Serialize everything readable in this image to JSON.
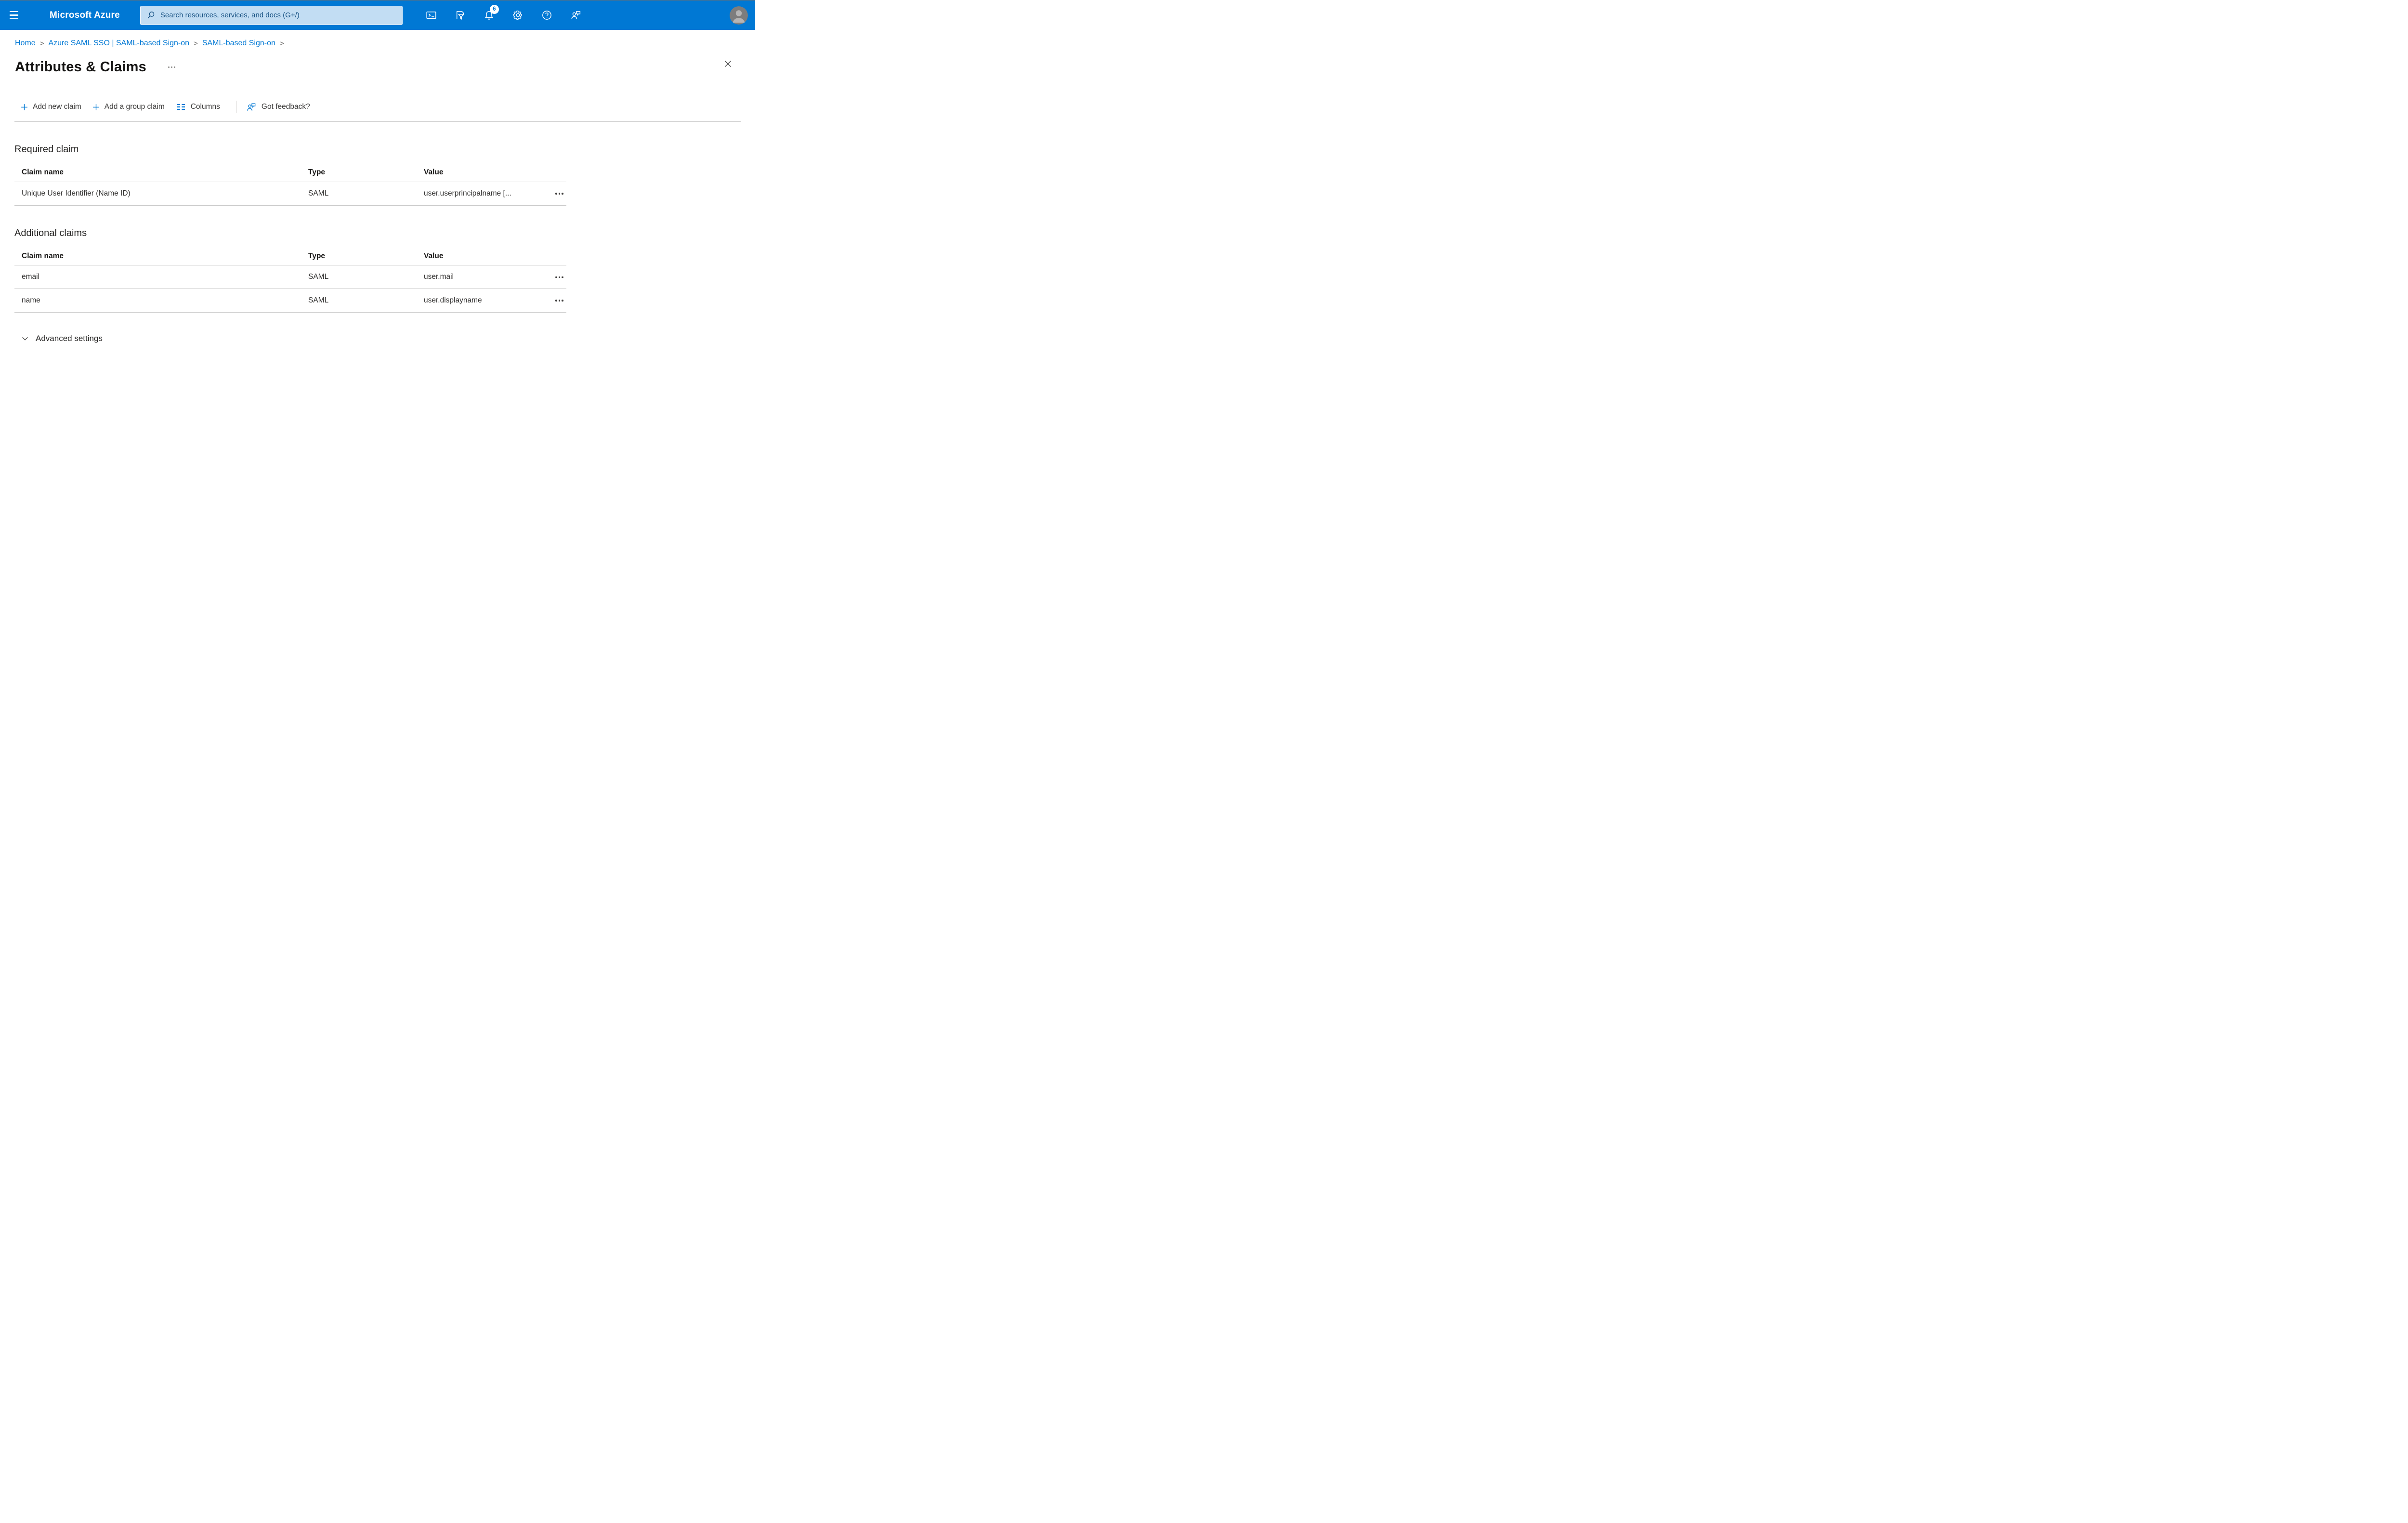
{
  "colors": {
    "accent": "#0078d4",
    "topbar_bg": "#0078d4",
    "search_bg": "#c2ddf3",
    "search_text": "#1a5485",
    "link": "#0078d4",
    "text_primary": "#323130",
    "heading": "#1b1a19",
    "toolbar_rule": "#d7d7d7",
    "table_header_border": "#e5e5e5",
    "table_row_border": "#c8c8c8"
  },
  "topbar": {
    "brand": "Microsoft Azure",
    "search_placeholder": "Search resources, services, and docs (G+/)",
    "notification_count": "6",
    "icons": [
      "cloud-shell",
      "filter",
      "notifications",
      "settings",
      "help",
      "feedback"
    ]
  },
  "breadcrumb": {
    "separator": ">",
    "items": [
      {
        "label": "Home"
      },
      {
        "label": "Azure SAML SSO | SAML-based Sign-on"
      },
      {
        "label": "SAML-based Sign-on"
      }
    ]
  },
  "page": {
    "title": "Attributes & Claims"
  },
  "toolbar": {
    "add_new_claim": "Add new claim",
    "add_group_claim": "Add a group claim",
    "columns": "Columns",
    "got_feedback": "Got feedback?"
  },
  "required_claim": {
    "heading": "Required claim",
    "columns": {
      "claim_name": "Claim name",
      "type": "Type",
      "value": "Value"
    },
    "rows": [
      {
        "claim_name": "Unique User Identifier (Name ID)",
        "type": "SAML",
        "value": "user.userprincipalname [..."
      }
    ]
  },
  "additional_claims": {
    "heading": "Additional claims",
    "columns": {
      "claim_name": "Claim name",
      "type": "Type",
      "value": "Value"
    },
    "rows": [
      {
        "claim_name": "email",
        "type": "SAML",
        "value": "user.mail"
      },
      {
        "claim_name": "name",
        "type": "SAML",
        "value": "user.displayname"
      }
    ]
  },
  "advanced_settings": {
    "label": "Advanced settings"
  }
}
